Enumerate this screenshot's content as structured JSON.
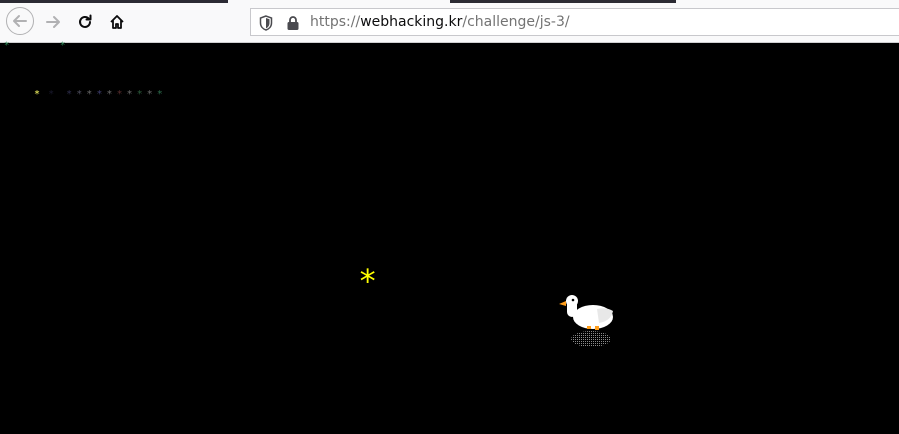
{
  "browser": {
    "url_scheme": "https://",
    "url_host": "webhacking.kr",
    "url_path": "/challenge/js-3/",
    "icons": [
      "back-arrow-icon",
      "forward-arrow-icon",
      "reload-icon",
      "home-icon",
      "shield-icon",
      "lock-icon"
    ]
  },
  "page": {
    "stars_top": [
      "*",
      "*"
    ],
    "stars_row": [
      "*",
      "*",
      "*",
      "*",
      "*",
      "*",
      "*",
      "*",
      "*",
      "*",
      "*",
      "*"
    ],
    "big_star": "*",
    "colors": {
      "background": "#000000",
      "big_star": "#ffff00",
      "green_star": "#2e8b57",
      "gray_star": "#6b6b6b"
    }
  }
}
